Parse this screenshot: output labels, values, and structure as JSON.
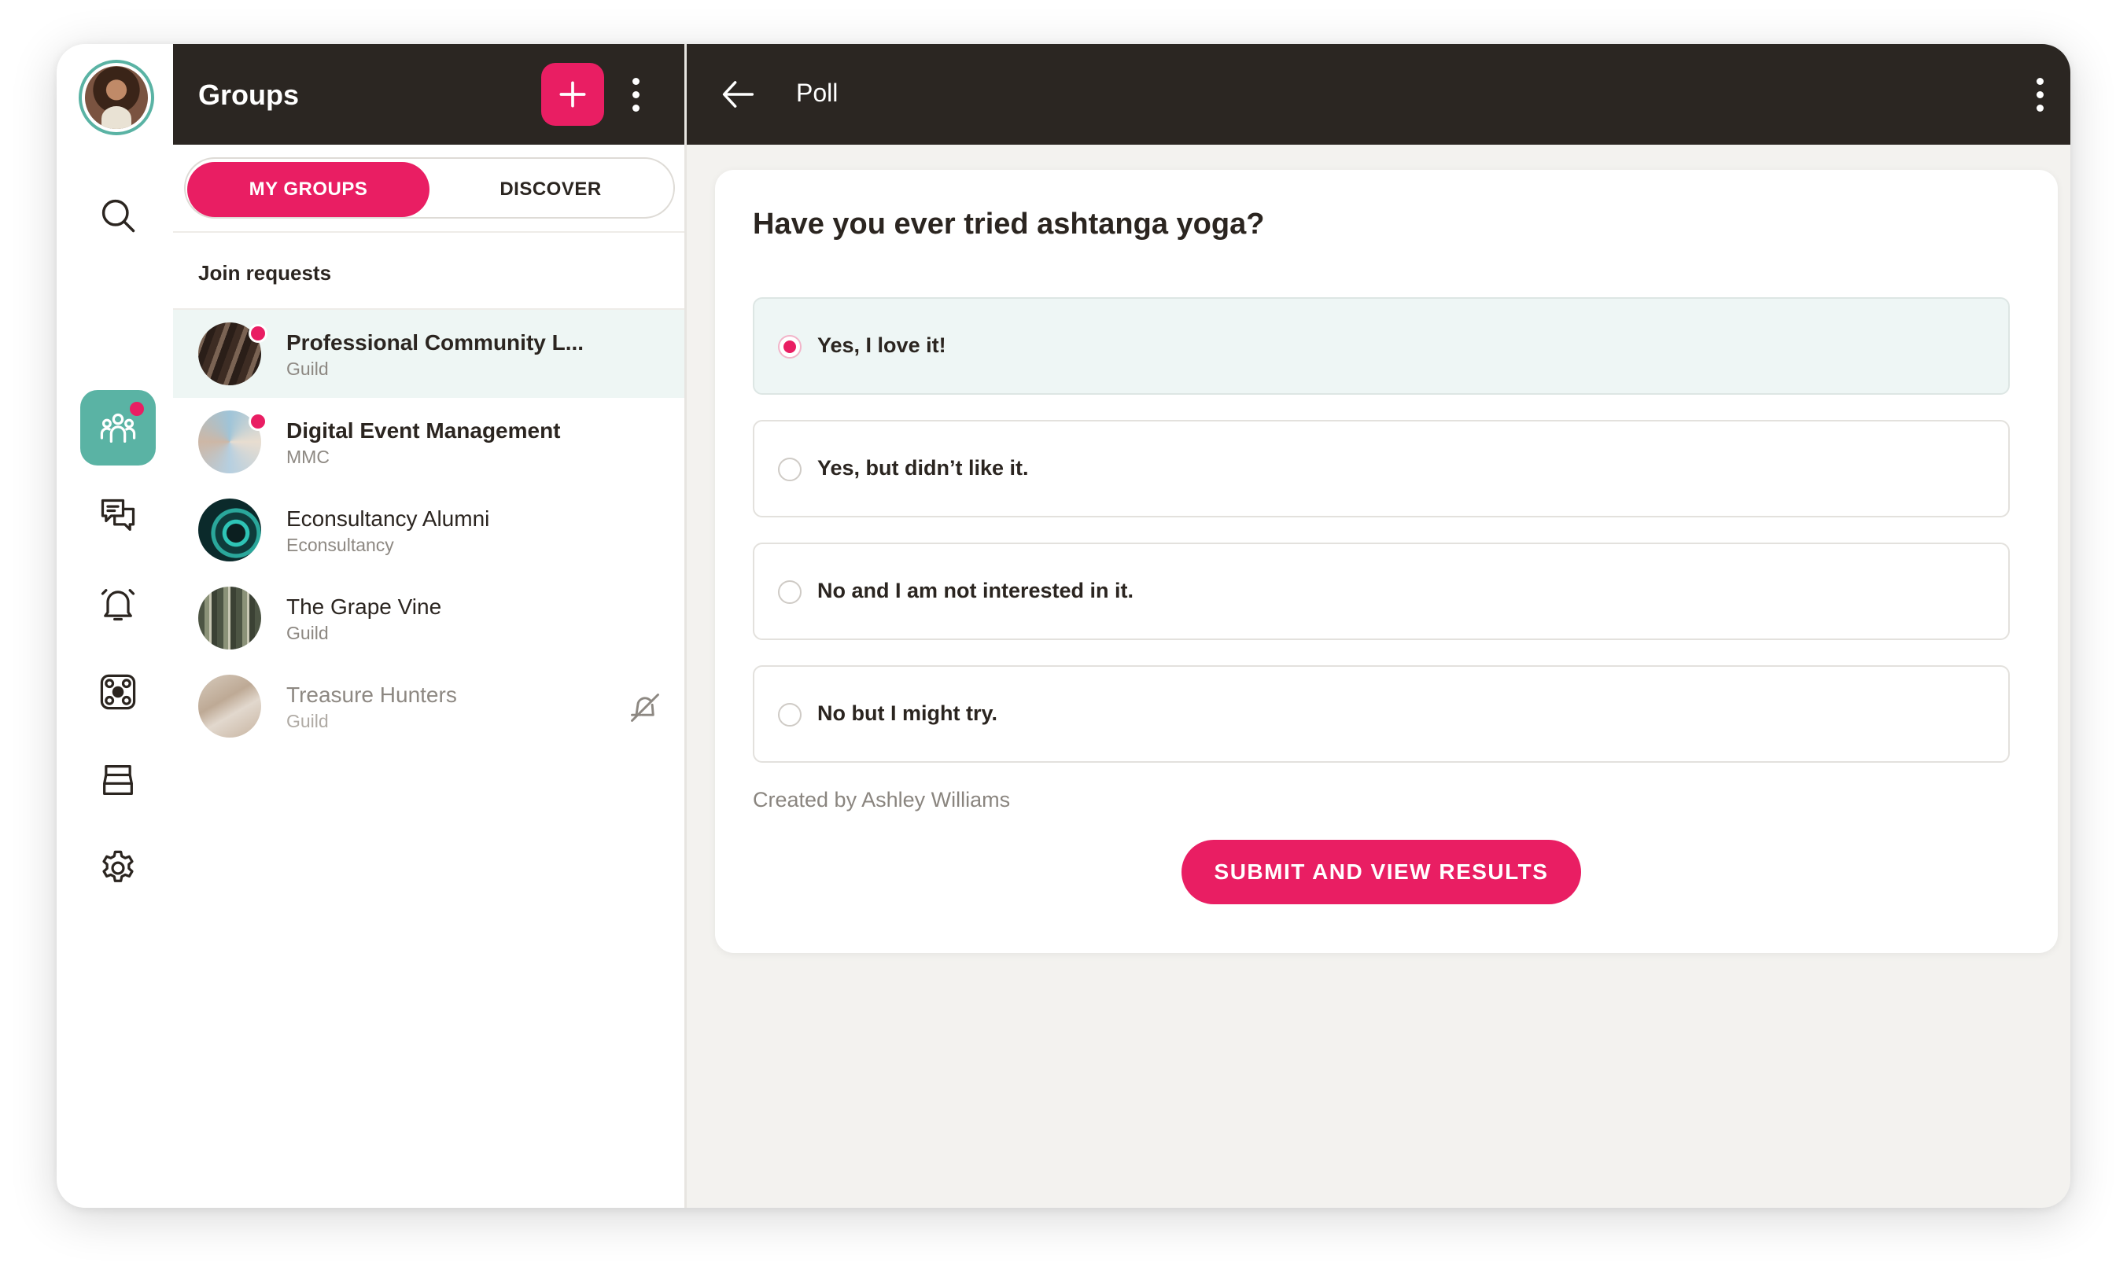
{
  "colors": {
    "accent": "#e91e63",
    "teal": "#5ab3a4",
    "header_bg": "#2b2622",
    "panel_bg": "#f3f2ef"
  },
  "rail": {
    "avatar": "user-avatar",
    "items": [
      {
        "name": "search",
        "icon": "search-icon",
        "active": false
      },
      {
        "name": "groups",
        "icon": "groups-icon",
        "active": true,
        "notification": true
      },
      {
        "name": "messages",
        "icon": "chat-icon",
        "active": false
      },
      {
        "name": "notifications",
        "icon": "bell-icon",
        "active": false
      },
      {
        "name": "apps",
        "icon": "apps-icon",
        "active": false
      },
      {
        "name": "library",
        "icon": "stack-icon",
        "active": false
      },
      {
        "name": "settings",
        "icon": "gear-icon",
        "active": false
      }
    ]
  },
  "groups_panel": {
    "title": "Groups",
    "tabs": {
      "my_groups": "MY GROUPS",
      "discover": "DISCOVER",
      "active": "my_groups"
    },
    "join_requests": "Join requests",
    "groups": [
      {
        "name": "Professional Community L...",
        "sub": "Guild",
        "unread": true,
        "bold": true,
        "selected": true,
        "muted": false
      },
      {
        "name": "Digital Event Management",
        "sub": "MMC",
        "unread": true,
        "bold": true,
        "selected": false,
        "muted": false
      },
      {
        "name": "Econsultancy Alumni",
        "sub": "Econsultancy",
        "unread": false,
        "bold": false,
        "selected": false,
        "muted": false
      },
      {
        "name": "The Grape Vine",
        "sub": "Guild",
        "unread": false,
        "bold": false,
        "selected": false,
        "muted": false
      },
      {
        "name": "Treasure Hunters",
        "sub": "Guild",
        "unread": false,
        "bold": false,
        "selected": false,
        "muted": true
      }
    ]
  },
  "poll": {
    "header_title": "Poll",
    "question": "Have you ever tried ashtanga yoga?",
    "options": [
      {
        "label": "Yes, I love it!",
        "selected": true
      },
      {
        "label": "Yes, but didn’t like it.",
        "selected": false
      },
      {
        "label": "No and I am not interested in it.",
        "selected": false
      },
      {
        "label": "No but I might try.",
        "selected": false
      }
    ],
    "created_by": "Created by Ashley Williams",
    "submit_label": "SUBMIT AND VIEW RESULTS"
  }
}
